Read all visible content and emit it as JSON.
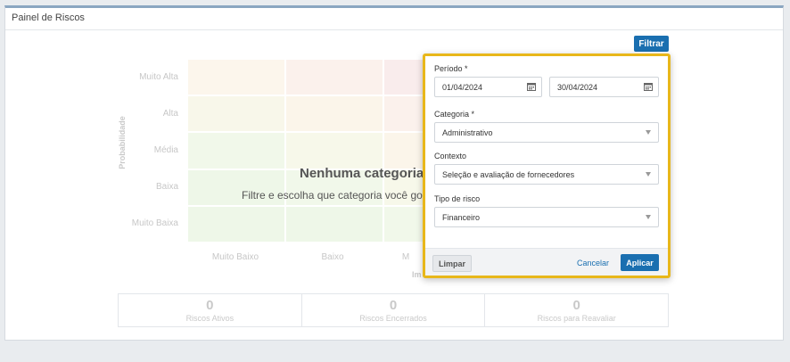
{
  "panel": {
    "title": "Painel de Riscos"
  },
  "filter_button": "Filtrar",
  "heatmap": {
    "y_title": "Probabilidade",
    "rows": [
      "Muito Alta",
      "Alta",
      "Média",
      "Baixa",
      "Muito Baixa"
    ],
    "columns": [
      "Muito Baixo",
      "Baixo",
      "M"
    ],
    "x_title": "Im"
  },
  "empty_state": {
    "title": "Nenhuma categoria s",
    "subtitle": "Filtre e escolha que categoria você gosta"
  },
  "stats": [
    {
      "value": "0",
      "label": "Riscos Ativos"
    },
    {
      "value": "0",
      "label": "Riscos Encerrados"
    },
    {
      "value": "0",
      "label": "Riscos para Reavaliar"
    }
  ],
  "popup": {
    "periodo_label": "Período *",
    "start_date": "01/04/2024",
    "end_date": "30/04/2024",
    "categoria_label": "Categoria *",
    "categoria_value": "Administrativo",
    "contexto_label": "Contexto",
    "contexto_value": "Seleção e avaliação de fornecedores",
    "tipo_label": "Tipo de risco",
    "tipo_value": "Financeiro",
    "limpar": "Limpar",
    "cancelar": "Cancelar",
    "aplicar": "Aplicar"
  }
}
